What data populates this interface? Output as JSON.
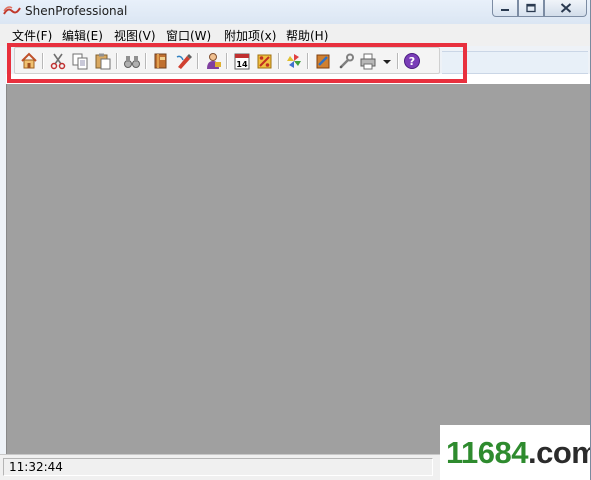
{
  "window": {
    "title": "ShenProfessional"
  },
  "menu": [
    {
      "id": "file",
      "label": "文件(F)"
    },
    {
      "id": "edit",
      "label": "编辑(E)"
    },
    {
      "id": "view",
      "label": "视图(V)"
    },
    {
      "id": "window",
      "label": "窗口(W)"
    },
    {
      "id": "addons",
      "label": "附加项(x)"
    },
    {
      "id": "help",
      "label": "帮助(H)"
    }
  ],
  "toolbar": {
    "icons": [
      "home-icon",
      "scissors-icon",
      "copy-icon",
      "paste-icon",
      "binoculars-icon",
      "book-icon",
      "edit-pen-icon",
      "person-icon",
      "calendar-icon",
      "percent-icon",
      "pinwheel-icon",
      "pencil-tool-icon",
      "wrench-icon",
      "printer-icon",
      "dropdown-arrow-icon",
      "help-icon"
    ],
    "calendar_day": "14"
  },
  "status": {
    "time": "11:32:44"
  },
  "watermark": {
    "part1": "11684",
    "part2": ".com"
  },
  "colors": {
    "highlight": "#e8303e",
    "workspace": "#a0a0a0",
    "watermark_green": "#2e8b2e"
  }
}
